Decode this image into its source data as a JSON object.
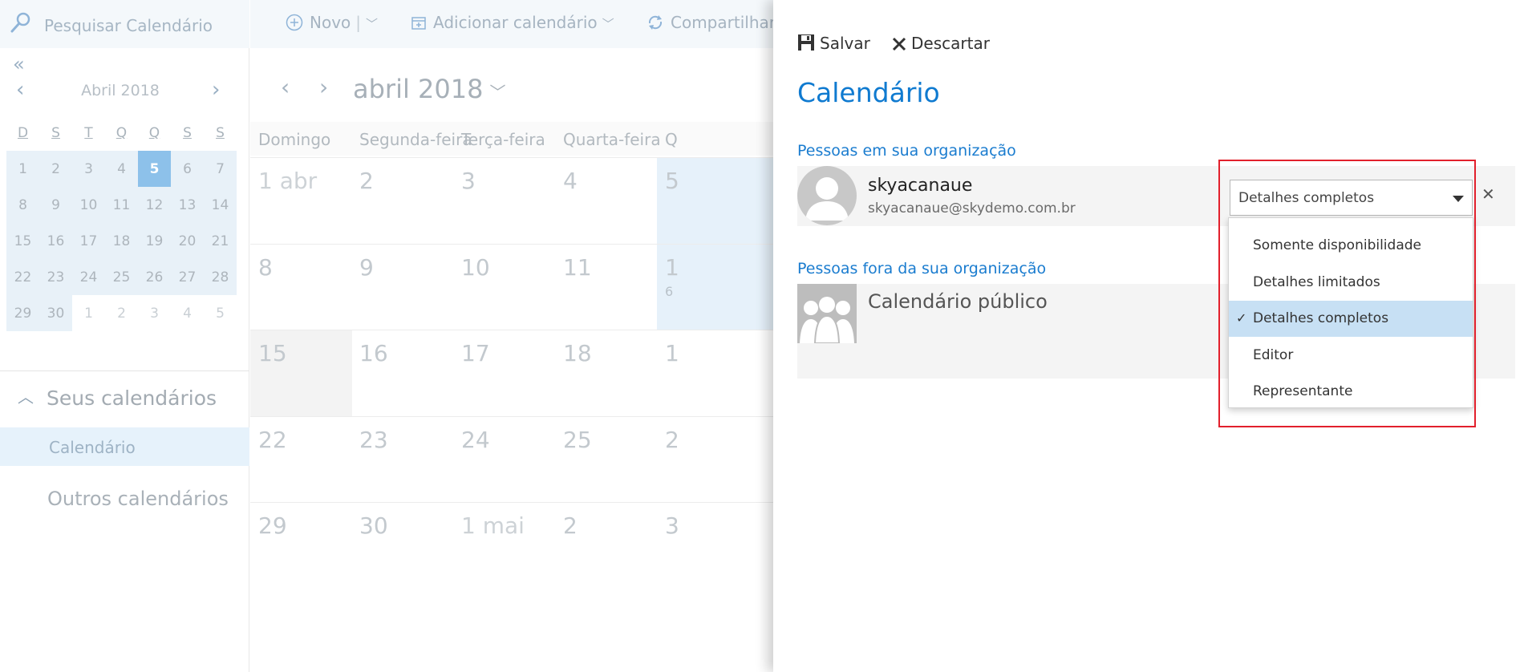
{
  "search": {
    "placeholder": "Pesquisar Calendário"
  },
  "toolbar": {
    "new_label": "Novo",
    "add_calendar_label": "Adicionar calendário",
    "share_label": "Compartilhar"
  },
  "mini_calendar": {
    "title": "Abril 2018",
    "weekdays": [
      "D",
      "S",
      "T",
      "Q",
      "Q",
      "S",
      "S"
    ],
    "days": [
      "1",
      "2",
      "3",
      "4",
      "5",
      "6",
      "7",
      "8",
      "9",
      "10",
      "11",
      "12",
      "13",
      "14",
      "15",
      "16",
      "17",
      "18",
      "19",
      "20",
      "21",
      "22",
      "23",
      "24",
      "25",
      "26",
      "27",
      "28",
      "29",
      "30",
      "1",
      "2",
      "3",
      "4",
      "5"
    ],
    "today": "5"
  },
  "sidebar": {
    "your_calendars": "Seus calendários",
    "calendar_item": "Calendário",
    "other_calendars": "Outros calendários"
  },
  "month_view": {
    "title": "abril 2018",
    "weekdays": [
      "Domingo",
      "Segunda-feira",
      "Terça-feira",
      "Quarta-feira",
      "Q"
    ],
    "rows": [
      [
        "1 abr",
        "2",
        "3",
        "4",
        "5"
      ],
      [
        "8",
        "9",
        "10",
        "11",
        "1"
      ],
      [
        "15",
        "16",
        "17",
        "18",
        "1"
      ],
      [
        "22",
        "23",
        "24",
        "25",
        "2"
      ],
      [
        "29",
        "30",
        "1 mai",
        "2",
        "3"
      ]
    ],
    "extra_fragment": "6"
  },
  "panel": {
    "save_label": "Salvar",
    "discard_label": "Descartar",
    "title": "Calendário",
    "section_inside": "Pessoas em sua organização",
    "person_name": "skyacanaue",
    "person_email": "skyacanaue@skydemo.com.br",
    "section_outside": "Pessoas fora da sua organização",
    "public_calendar": "Calendário público"
  },
  "permission_dropdown": {
    "selected": "Detalhes completos",
    "options": [
      "Somente disponibilidade",
      "Detalhes limitados",
      "Detalhes completos",
      "Editor",
      "Representante"
    ]
  },
  "colors": {
    "accent": "#0f7ad0",
    "selected_option": "#c7e0f4",
    "highlight_box": "#e2202c"
  }
}
